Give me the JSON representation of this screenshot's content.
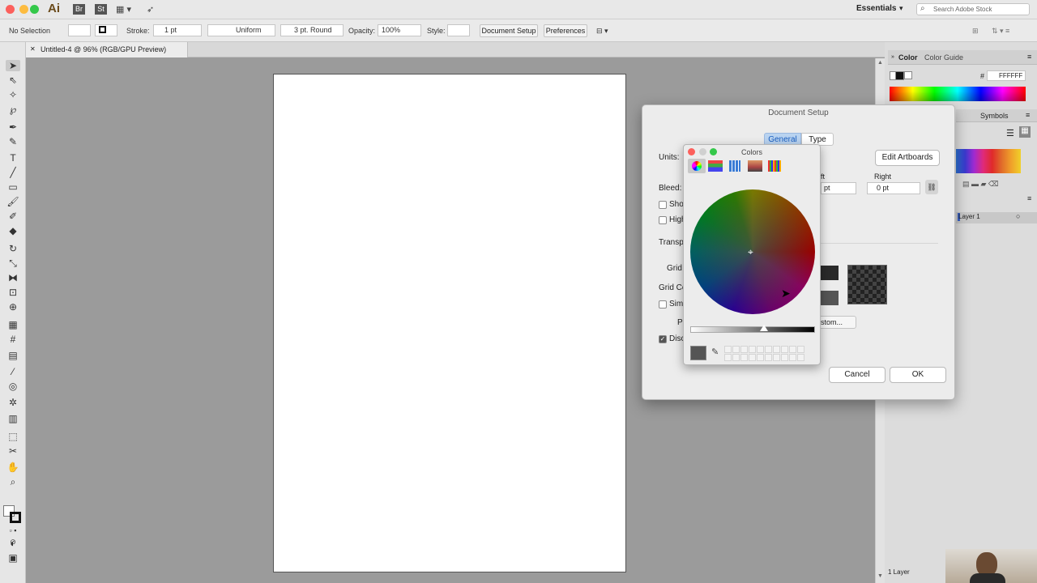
{
  "app": {
    "name": "Ai",
    "bridge": "Br",
    "stock": "St",
    "workspace": "Essentials",
    "search_placeholder": "Search Adobe Stock"
  },
  "control_bar": {
    "selection": "No Selection",
    "stroke_label": "Stroke:",
    "stroke_value": "1 pt",
    "profile": "Uniform",
    "brush": "3 pt. Round",
    "opacity_label": "Opacity:",
    "opacity_value": "100%",
    "style_label": "Style:",
    "doc_setup_button": "Document Setup",
    "preferences_button": "Preferences"
  },
  "document_tab": {
    "close": "✕",
    "title": "Untitled-4 @ 96% (RGB/GPU Preview)"
  },
  "color_panel": {
    "tab_color": "Color",
    "tab_guide": "Color Guide",
    "hex_label": "#",
    "hex_value": "FFFFFF"
  },
  "symbols_panel": {
    "tab": "Symbols"
  },
  "layers_panel": {
    "layer_name": "Layer 1",
    "count": "1 Layer"
  },
  "document_setup": {
    "title": "Document Setup",
    "tab_general": "General",
    "tab_type": "Type",
    "units_label": "Units:",
    "edit_artboards": "Edit Artboards",
    "bleed_label": "Bleed:",
    "left_label": "ft",
    "left_value": "pt",
    "right_label": "Right",
    "right_value": "0 pt",
    "show_label": "Show",
    "high_label": "High",
    "transp_label": "Transp",
    "grid_label": "Grid",
    "grid_colors_label": "Grid Co",
    "simulate_label": "Simu",
    "preset_label": "Pr",
    "custom_button": "stom...",
    "discard_label": "Disc",
    "cancel": "Cancel",
    "ok": "OK"
  },
  "colors_popup": {
    "title": "Colors",
    "mode_icons": [
      "color-wheel-icon",
      "color-sliders-icon",
      "color-palettes-icon",
      "image-palettes-icon",
      "pencils-icon"
    ]
  },
  "colors": {
    "accent": "#3a7bd5",
    "selected_tab": "#b9d3f0"
  }
}
